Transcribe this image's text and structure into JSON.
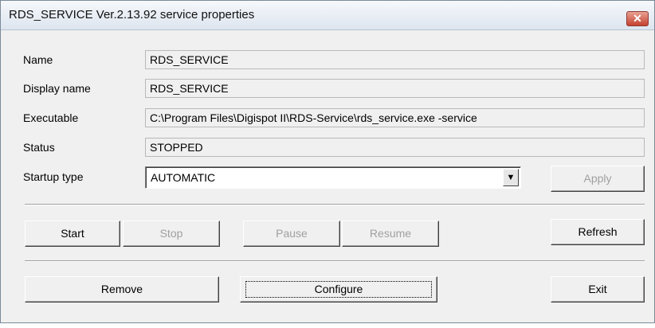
{
  "window": {
    "title": "RDS_SERVICE Ver.2.13.92 service properties",
    "close_glyph": "✕"
  },
  "fields": {
    "name_label": "Name",
    "name_value": "RDS_SERVICE",
    "display_label": "Display name",
    "display_value": "RDS_SERVICE",
    "exec_label": "Executable",
    "exec_value": "C:\\Program Files\\Digispot II\\RDS-Service\\rds_service.exe -service",
    "status_label": "Status",
    "status_value": "STOPPED",
    "startup_label": "Startup type",
    "startup_value": "AUTOMATIC",
    "dropdown_glyph": "▼"
  },
  "buttons": {
    "apply": "Apply",
    "start": "Start",
    "stop": "Stop",
    "pause": "Pause",
    "resume": "Resume",
    "refresh": "Refresh",
    "remove": "Remove",
    "configure": "Configure",
    "exit": "Exit"
  }
}
